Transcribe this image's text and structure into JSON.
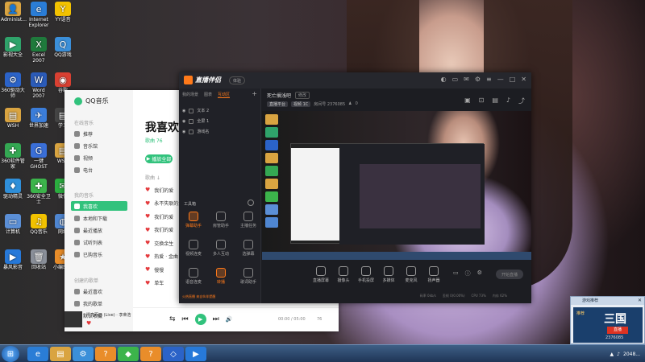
{
  "desktop": {
    "icons": [
      {
        "label": "Administ...",
        "color": "#d9a441",
        "glyph": "👤"
      },
      {
        "label": "Internet Explorer",
        "color": "#2a7dd6",
        "glyph": "e"
      },
      {
        "label": "YY语音",
        "color": "#f2c200",
        "glyph": "Y"
      },
      {
        "label": "影视大全",
        "color": "#2fa36a",
        "glyph": "▶"
      },
      {
        "label": "Excel 2007",
        "color": "#1f7a3c",
        "glyph": "X"
      },
      {
        "label": "QQ游戏",
        "color": "#3b8fd9",
        "glyph": "Q"
      },
      {
        "label": "360驱动大师",
        "color": "#2b63c8",
        "glyph": "⚙"
      },
      {
        "label": "Word 2007",
        "color": "#2b5bb8",
        "glyph": "W"
      },
      {
        "label": "谷歌",
        "color": "#d94032",
        "glyph": "◉"
      },
      {
        "label": "WSH",
        "color": "#d9a441",
        "glyph": "▤"
      },
      {
        "label": "世界加速",
        "color": "#3b7dd9",
        "glyph": "✈"
      },
      {
        "label": "学习",
        "color": "#444444",
        "glyph": "▤"
      },
      {
        "label": "360软件管家",
        "color": "#34a853",
        "glyph": "✚"
      },
      {
        "label": "一键GHOST",
        "color": "#3a6fd8",
        "glyph": "G"
      },
      {
        "label": "WSH",
        "color": "#d9a441",
        "glyph": "▤"
      },
      {
        "label": "驱动精灵",
        "color": "#2f8fd9",
        "glyph": "♦"
      },
      {
        "label": "360安全卫士",
        "color": "#3cb44b",
        "glyph": "✚"
      },
      {
        "label": "微信",
        "color": "#2bad3f",
        "glyph": "✉"
      },
      {
        "label": "计算机",
        "color": "#5b8fd6",
        "glyph": "▭"
      },
      {
        "label": "QQ音乐",
        "color": "#f2c200",
        "glyph": "♫"
      },
      {
        "label": "网络",
        "color": "#4f86d1",
        "glyph": "◍"
      },
      {
        "label": "暴风影音",
        "color": "#2779d9",
        "glyph": "▶"
      },
      {
        "label": "回收站",
        "color": "#8a8f99",
        "glyph": "🗑"
      },
      {
        "label": "小编助手",
        "color": "#e98d2a",
        "glyph": "★"
      }
    ]
  },
  "taskbar": {
    "apps": [
      "e",
      "▤",
      "⚙",
      "?",
      "◆",
      "?",
      "◇",
      "▶"
    ],
    "clock": "2048..."
  },
  "qqmusic": {
    "app_name": "QQ音乐",
    "group_online": "在线音乐",
    "nav_online": [
      "推荐",
      "音乐馆",
      "视频",
      "电台"
    ],
    "group_mine": "我的音乐",
    "nav_mine": [
      "我喜欢",
      "本地和下载",
      "最近播放",
      "试听列表",
      "已购音乐"
    ],
    "group_created": "创建的歌单",
    "nav_created": [
      "最近喜欢",
      "我的歌单",
      "默认收藏"
    ],
    "page_title": "我喜欢",
    "tab_songs": "歌曲 76",
    "play_all": "播放全部",
    "list_header": "歌曲 ↓",
    "songs": [
      "我们的爱",
      "永不失联的爱",
      "我们的爱",
      "我们的爱",
      "交换余生",
      "热爱 · 金曲",
      "慢慢",
      "单车"
    ],
    "now_playing": "漂亮而已 (Live) · 李荣浩",
    "time": "00:00 / 05:00",
    "count": "76"
  },
  "live": {
    "app_name": "直播伴侣",
    "version_badge": "体验",
    "tabs": [
      "我的场景",
      "图表",
      "互动区"
    ],
    "active_tab": "互动区",
    "scenes": [
      "文本 2",
      "全屏 1",
      "游戏名"
    ],
    "tools_label": "工具箱",
    "tools": [
      {
        "label": "弹幕助手",
        "hot": true
      },
      {
        "label": "房管助手",
        "hot": false
      },
      {
        "label": "主播任务",
        "hot": false
      },
      {
        "label": "视频连麦",
        "hot": false
      },
      {
        "label": "多人互动",
        "hot": false
      },
      {
        "label": "选弹幕",
        "hot": false
      },
      {
        "label": "语音连麦",
        "hot": false
      },
      {
        "label": "转播",
        "hot": true
      },
      {
        "label": "歌词助手",
        "hot": false
      }
    ],
    "room_title": "死亡搁浅吧",
    "room_tag": "修改",
    "room_meta": [
      "直播平台",
      "视频 1C"
    ],
    "room_id": "房间号 2376085",
    "fans": "0",
    "bottom_tools": [
      "直播屏幕",
      "摄像头",
      "手机投屏",
      "多媒体",
      "麦克风",
      "扬声器"
    ],
    "start_live": "开始直播",
    "status": [
      "码率 0kb/s",
      "丢帧 0(0.00%)",
      "CPU 73%",
      "内存 62%"
    ],
    "notice": "火热直播 来自伙伴提醒"
  },
  "popup": {
    "title": "游戏推荐",
    "text": "推荐",
    "big": "三国",
    "red": "直播",
    "num": "2376085"
  }
}
